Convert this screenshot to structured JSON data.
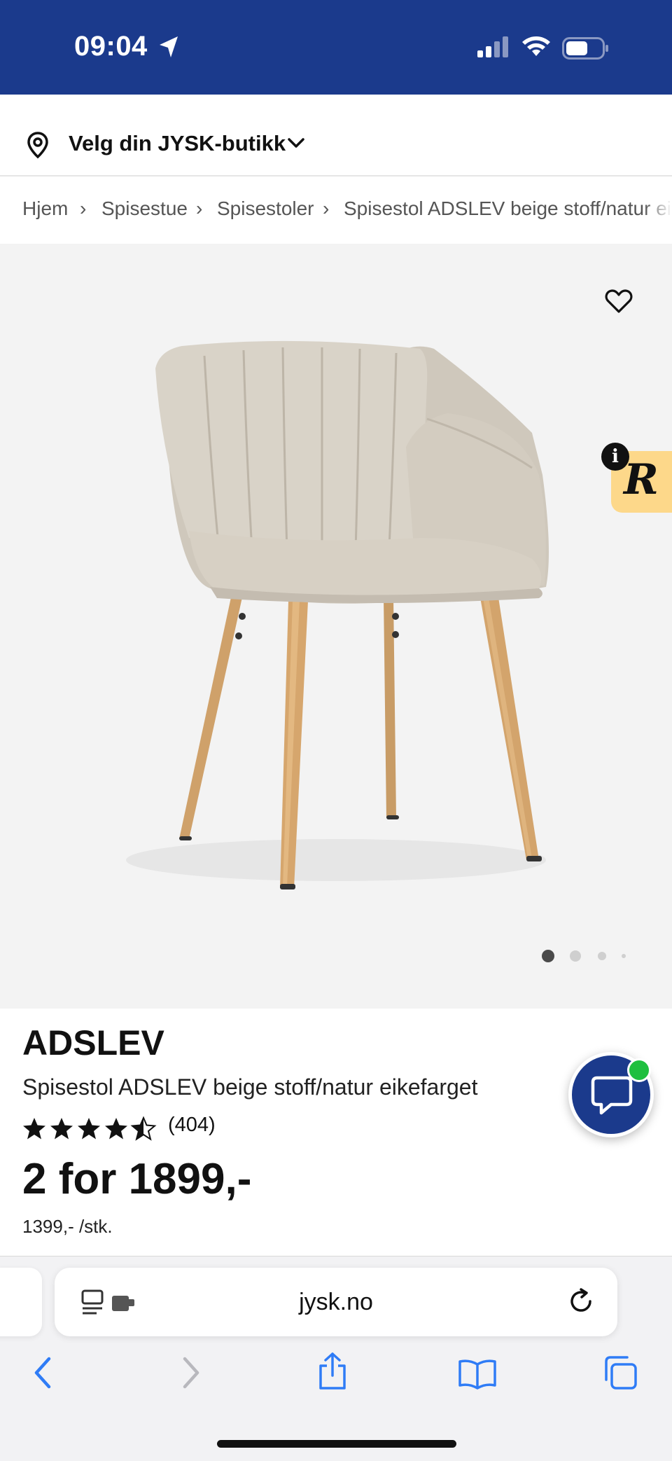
{
  "status_bar": {
    "time": "09:04",
    "bg_color": "#1b3a8c"
  },
  "store": {
    "label": "Velg din JYSK-butikk",
    "icon": "location-pin-icon"
  },
  "breadcrumb": {
    "items": [
      "Hjem",
      "Spisestue",
      "Spisestoler",
      "Spisestol ADSLEV beige stoff/natur eikefarget"
    ]
  },
  "gallery": {
    "image_count": 4,
    "active_index": 0
  },
  "widget": {
    "r_letter": "R",
    "info_letter": "i"
  },
  "product": {
    "brand": "ADSLEV",
    "name": "Spisestol ADSLEV beige stoff/natur eikefarget",
    "rating": 4.5,
    "review_count": "(404)",
    "price": "2 for 1899,-",
    "unit_price": "1399,- /stk."
  },
  "browser": {
    "url": "jysk.no"
  },
  "colors": {
    "brand_blue": "#1b3a8c",
    "online_green": "#1fbf3f",
    "widget_yellow": "#fdd88a",
    "ios_blue": "#2f7cf6"
  }
}
